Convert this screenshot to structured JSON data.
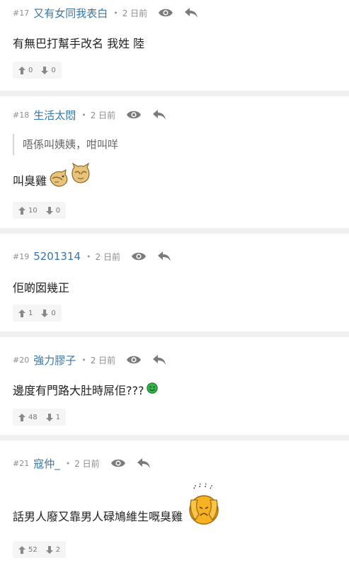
{
  "posts": [
    {
      "num": "#17",
      "user": "又有女同我表白",
      "time": "2 日前",
      "content": "有無巴打幫手改名 我姓 陸",
      "up": "0",
      "down": "0"
    },
    {
      "num": "#18",
      "user": "生活太悶",
      "time": "2 日前",
      "quote": "唔係叫姨姨，咁叫咩",
      "content": "叫臭雞",
      "up": "10",
      "down": "0"
    },
    {
      "num": "#19",
      "user": "5201314",
      "time": "2 日前",
      "content": "佢啲囡幾正",
      "up": "1",
      "down": "0"
    },
    {
      "num": "#20",
      "user": "強力膠子",
      "time": "2 日前",
      "content": "邊度有門路大肚時屌佢???",
      "up": "48",
      "down": "1"
    },
    {
      "num": "#21",
      "user": "寇仲_",
      "time": "2 日前",
      "content": "話男人廢又靠男人碌鳩維生嘅臭雞",
      "up": "52",
      "down": "2"
    }
  ],
  "separator_dot": "•",
  "icons": {
    "view": "eye-icon",
    "reply": "reply-icon",
    "upvote": "thumb-up-arrow-icon",
    "downvote": "thumb-down-arrow-icon"
  },
  "colors": {
    "username": "#3a76a3",
    "meta": "#8d8d8d",
    "background": "#f3f3f3"
  }
}
